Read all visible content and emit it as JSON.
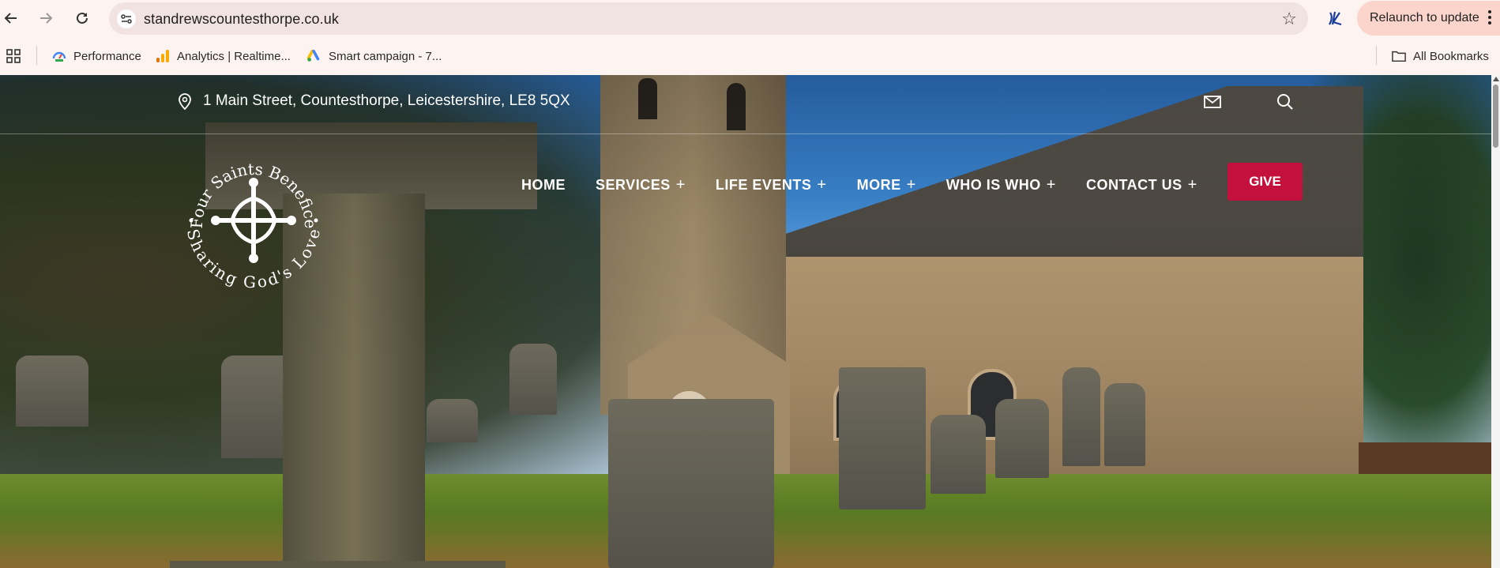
{
  "browser": {
    "url": "standrewscountesthorpe.co.uk",
    "relaunch_label": "Relaunch to update",
    "bookmarks": [
      {
        "label": "Performance",
        "icon": "performance-icon"
      },
      {
        "label": "Analytics | Realtime...",
        "icon": "analytics-icon"
      },
      {
        "label": "Smart campaign - 7...",
        "icon": "google-ads-icon"
      }
    ],
    "all_bookmarks_label": "All Bookmarks"
  },
  "site": {
    "address": "1 Main Street, Countesthorpe, Leicestershire, LE8 5QX",
    "logo": {
      "top_text": "Four Saints Benefice",
      "bottom_text": "Sharing God's Love"
    },
    "nav": [
      {
        "label": "HOME",
        "has_submenu": false
      },
      {
        "label": "SERVICES",
        "has_submenu": true
      },
      {
        "label": "LIFE EVENTS",
        "has_submenu": true
      },
      {
        "label": "MORE",
        "has_submenu": true
      },
      {
        "label": "WHO IS WHO",
        "has_submenu": true
      },
      {
        "label": "CONTACT US",
        "has_submenu": true
      }
    ],
    "plus_symbol": "+",
    "give_label": "GIVE",
    "accent_color": "#c3103c"
  }
}
